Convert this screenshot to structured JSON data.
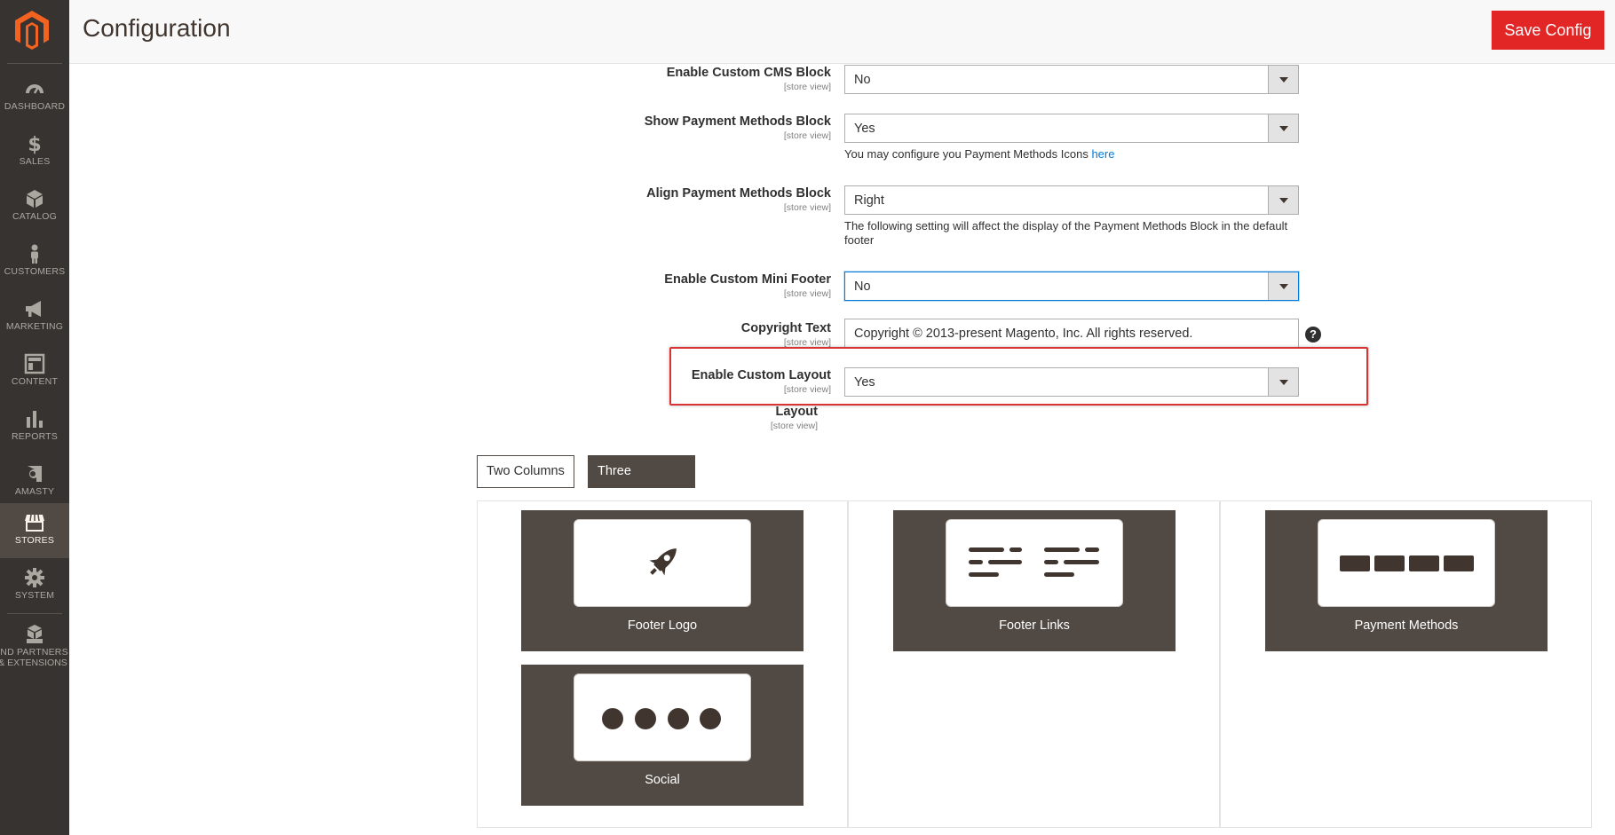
{
  "app": {
    "title": "Configuration",
    "save_label": "Save Config"
  },
  "sidebar": {
    "items": [
      {
        "label": "DASHBOARD",
        "icon": "dashboard-icon"
      },
      {
        "label": "SALES",
        "icon": "dollar-icon"
      },
      {
        "label": "CATALOG",
        "icon": "box-icon"
      },
      {
        "label": "CUSTOMERS",
        "icon": "person-icon"
      },
      {
        "label": "MARKETING",
        "icon": "megaphone-icon"
      },
      {
        "label": "CONTENT",
        "icon": "layout-icon"
      },
      {
        "label": "REPORTS",
        "icon": "bar-chart-icon"
      },
      {
        "label": "AMASTY",
        "icon": "amasty-icon"
      },
      {
        "label": "STORES",
        "icon": "store-icon"
      },
      {
        "label": "SYSTEM",
        "icon": "gear-icon"
      },
      {
        "label": "IND PARTNERS",
        "label2": "& EXTENSIONS",
        "icon": "cubes-icon"
      }
    ]
  },
  "form": {
    "scope": "[store view]",
    "enable_cms_block": {
      "label": "Enable Custom CMS Block",
      "value": "No"
    },
    "show_payment": {
      "label": "Show Payment Methods Block",
      "value": "Yes",
      "note": "You may configure you Payment Methods Icons ",
      "note_link": "here"
    },
    "align_payment": {
      "label": "Align Payment Methods Block",
      "value": "Right",
      "note_line1": "The following setting will affect the display of the Payment Methods Block in the default",
      "note_line2": "footer"
    },
    "mini_footer": {
      "label": "Enable Custom Mini Footer",
      "value": "No"
    },
    "copyright": {
      "label": "Copyright Text",
      "value": "Copyright © 2013-present Magento, Inc. All rights reserved.",
      "help": "?"
    },
    "custom_layout": {
      "label": "Enable Custom Layout",
      "value": "Yes"
    },
    "layout": {
      "label": "Layout"
    }
  },
  "layout_builder": {
    "tabs": [
      "Two Columns",
      "Three Columns"
    ],
    "active_tab": "Three Columns",
    "blocks": {
      "logo": "Footer Logo",
      "links": "Footer Links",
      "payment": "Payment Methods",
      "social": "Social"
    }
  },
  "colors": {
    "accent": "#e22626",
    "sidebar": "#373330",
    "block": "#514943",
    "link": "#007bdb"
  }
}
